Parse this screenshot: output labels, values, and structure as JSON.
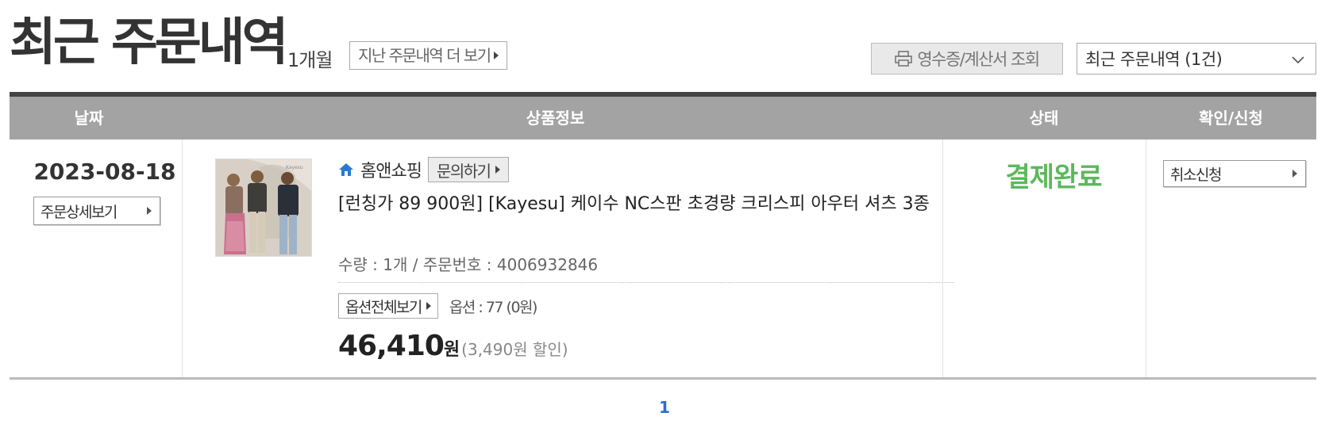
{
  "header": {
    "title": "최근 주문내역",
    "period": "1개월",
    "more_history_label": "지난 주문내역 더 보기",
    "receipt_label": "영수증/계산서 조회",
    "recent_select_value": "최근 주문내역 (1건)"
  },
  "table": {
    "columns": [
      "날짜",
      "상품정보",
      "상태",
      "확인/신청"
    ],
    "rows": [
      {
        "date": "2023-08-18",
        "detail_button": "주문상세보기",
        "vendor": "홈앤쇼핑",
        "inquiry_button": "문의하기",
        "product_name": "[런칭가 89 900원] [Kayesu] 케이수 NC스판 초경량 크리스피 아우터 셔츠 3종",
        "quantity_order": "수량 : 1개 / 주문번호 : 4006932846",
        "all_options_button": "옵션전체보기",
        "option": "옵션 : 77 (0원)",
        "price": "46,410",
        "price_unit": "원",
        "discount": "(3,490원 할인)",
        "status": "결제완료",
        "cancel_button": "취소신청"
      }
    ]
  },
  "pagination": {
    "current": "1"
  },
  "colors": {
    "status_green": "#5cb85c",
    "page_link_blue": "#2a6fd6",
    "header_gray": "#a3a3a3"
  },
  "icons": {
    "receipt": "printer-icon",
    "vendor": "home-icon",
    "select": "chevron-down-icon",
    "button_arrow": "triangle-right-icon"
  }
}
